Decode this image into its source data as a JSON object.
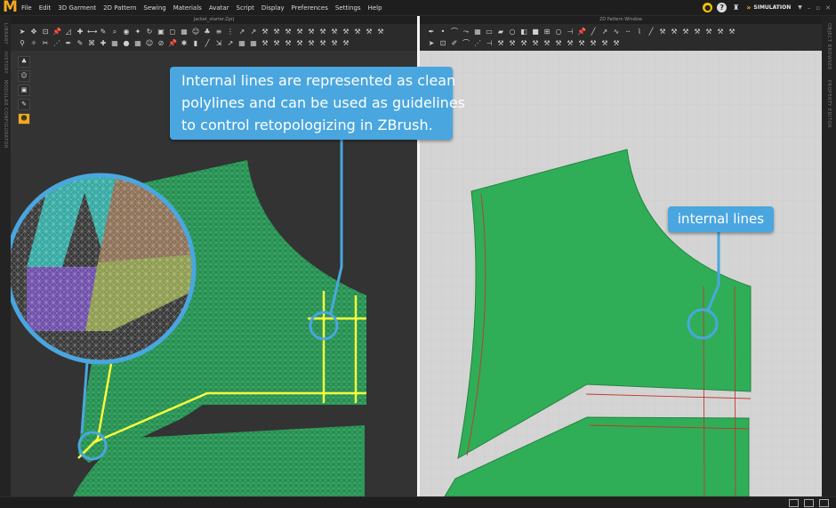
{
  "app": {
    "logo_letter": "M",
    "accent_color": "#f2a91e",
    "menu": [
      "File",
      "Edit",
      "3D Garment",
      "2D Pattern",
      "Sewing",
      "Materials",
      "Avatar",
      "Script",
      "Display",
      "Preferences",
      "Settings",
      "Help"
    ],
    "mode_label": "SIMULATION",
    "right_icons": [
      "cloud-icon",
      "help-icon",
      "avatar-hanger-icon"
    ],
    "window_controls": [
      "minimize",
      "restore",
      "close"
    ]
  },
  "panels": {
    "left_title": "Jacket_starter.Zprj",
    "right_title": "2D Pattern Window",
    "left_side_labels": [
      "LIBRARY",
      "HISTORY",
      "MODULAR CONFIGURATOR"
    ],
    "right_side_labels": [
      "OBJECT BROWSER",
      "PROPERTY EDITOR"
    ]
  },
  "toolbar3d": {
    "row1": [
      "select-icon",
      "move-icon",
      "transform-icon",
      "pin-icon",
      "fold-icon",
      "tack-icon",
      "measure-icon",
      "brush-icon",
      "zoom-icon",
      "camera-icon",
      "light-icon",
      "rotate-icon",
      "lock-icon",
      "cube-icon",
      "grid-icon",
      "avatar-icon",
      "shirt-icon",
      "layer-icon",
      "dots-icon",
      "arrow-icon",
      "arrow-icon",
      "tools-icon",
      "tools-icon",
      "tools-icon",
      "tools-icon",
      "tools-icon",
      "tools-icon",
      "tools-icon",
      "tools-icon",
      "tools-icon",
      "tools-icon",
      "tools-icon"
    ],
    "row2": [
      "walk-icon",
      "wand-icon",
      "scissors-icon",
      "sew-icon",
      "pen-icon",
      "brush-icon",
      "knit-icon",
      "tack-icon",
      "grid-icon",
      "sphere-icon",
      "grid-icon",
      "avatar-icon",
      "split-icon",
      "pin-icon",
      "star-icon",
      "bar-icon",
      "line-icon",
      "scale-icon",
      "arrow-icon",
      "grid-icon",
      "grid-icon",
      "tools-icon",
      "tools-icon",
      "tools-icon",
      "tools-icon",
      "tools-icon",
      "tools-icon",
      "tools-icon",
      "tools-icon"
    ]
  },
  "toolbar2d": {
    "row1": [
      "pen-icon",
      "point-icon",
      "curve-icon",
      "trace-icon",
      "grid-icon",
      "rect-icon",
      "shape-icon",
      "circle-icon",
      "mirror-icon",
      "square-icon",
      "seam-icon",
      "circle-icon",
      "notch-icon",
      "pin-icon",
      "line-icon",
      "arrow-icon",
      "wave-icon",
      "dash-icon",
      "zigzag-icon",
      "line-icon",
      "tools-icon",
      "tools-icon",
      "tools-icon",
      "tools-icon",
      "tools-icon",
      "tools-icon",
      "tools-icon"
    ],
    "row2": [
      "select-icon",
      "transform-icon",
      "edit-icon",
      "curve-icon",
      "sew-icon",
      "notch-icon",
      "tools-icon",
      "tools-icon",
      "tools-icon",
      "tools-icon",
      "tools-icon",
      "tools-icon",
      "tools-icon",
      "tools-icon",
      "tools-icon",
      "tools-icon",
      "tools-icon"
    ]
  },
  "avatar_tools": [
    "shirt-icon",
    "avatar-icon",
    "fold-icon",
    "pencil-icon",
    "avatar-icon"
  ],
  "callouts": {
    "main_lines": [
      "Internal lines are represented as clean",
      "polylines and can be used as guidelines",
      "to control retopologizing in ZBrush."
    ],
    "small": "internal lines"
  },
  "colors": {
    "pattern_green": "#2fae57",
    "mesh_green": "#2a8a52",
    "highlight_yellow": "#ffff3a",
    "callout_blue": "#4aa6df",
    "internal_line_red": "#c0392b"
  }
}
